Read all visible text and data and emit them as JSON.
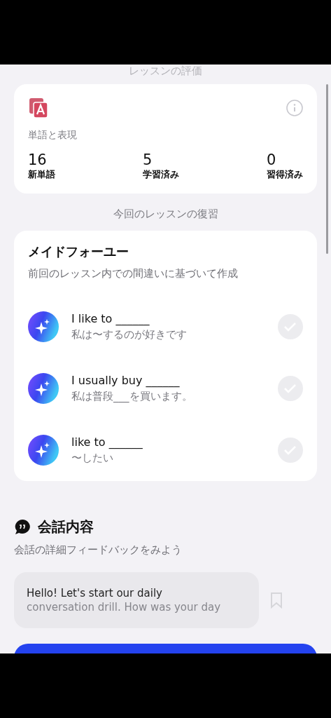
{
  "header": {
    "title": "レッスンの評価"
  },
  "vocab_card": {
    "title": "単語と表現",
    "stats": [
      {
        "value": "16",
        "label": "新単語"
      },
      {
        "value": "5",
        "label": "学習済み"
      },
      {
        "value": "0",
        "label": "習得済み"
      }
    ]
  },
  "review_heading": "今回のレッスンの復習",
  "made_for_you": {
    "title": "メイドフォーユー",
    "subtitle": "前回のレッスン内での間違いに基づいて作成",
    "items": [
      {
        "phrase": "I like to ______",
        "translation": "私は〜するのが好きです",
        "checked": false
      },
      {
        "phrase": "I usually buy ______",
        "translation": "私は普段___を買います。",
        "checked": false
      },
      {
        "phrase": "like to ______",
        "translation": "〜したい",
        "checked": false
      }
    ]
  },
  "conversation": {
    "title": "会話内容",
    "subtitle": "会話の詳細フィードバックをみよう",
    "messages": [
      {
        "lines": [
          "Hello! Let's start our daily",
          "conversation drill. How was your day"
        ],
        "bookmarked": false
      }
    ]
  }
}
